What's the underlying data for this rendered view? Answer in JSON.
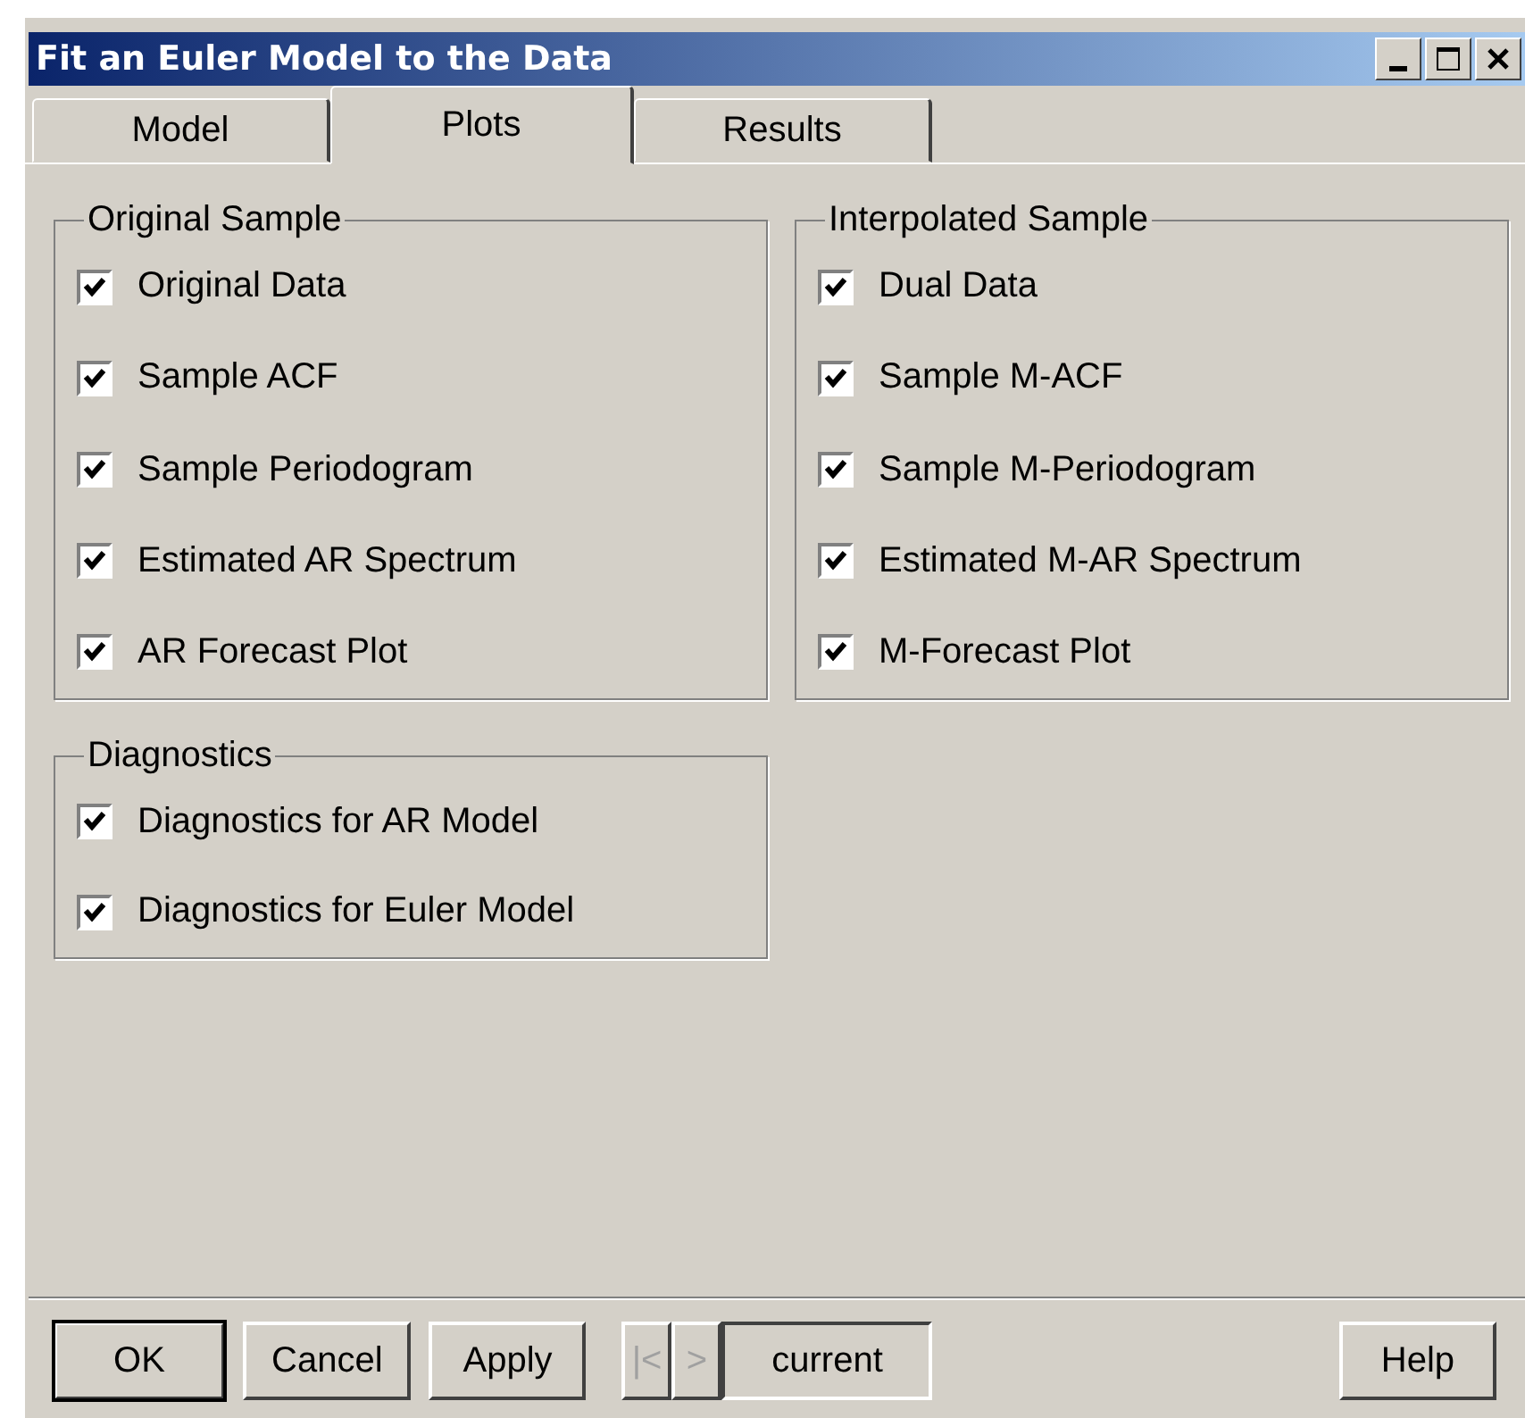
{
  "window": {
    "title": "Fit an Euler Model to the Data"
  },
  "tabs": [
    {
      "label": "Model",
      "selected": false
    },
    {
      "label": "Plots",
      "selected": true
    },
    {
      "label": "Results",
      "selected": false
    }
  ],
  "groups": [
    {
      "title": "Original Sample",
      "items": [
        {
          "label": "Original Data",
          "checked": true
        },
        {
          "label": "Sample ACF",
          "checked": true
        },
        {
          "label": "Sample Periodogram",
          "checked": true
        },
        {
          "label": "Estimated AR Spectrum",
          "checked": true
        },
        {
          "label": "AR Forecast Plot",
          "checked": true
        }
      ]
    },
    {
      "title": "Interpolated Sample",
      "items": [
        {
          "label": "Dual Data",
          "checked": true
        },
        {
          "label": "Sample M-ACF",
          "checked": true
        },
        {
          "label": "Sample M-Periodogram",
          "checked": true
        },
        {
          "label": "Estimated M-AR Spectrum",
          "checked": true
        },
        {
          "label": "M-Forecast Plot",
          "checked": true
        }
      ]
    },
    {
      "title": "Diagnostics",
      "items": [
        {
          "label": "Diagnostics for AR Model",
          "checked": true
        },
        {
          "label": "Diagnostics for Euler Model",
          "checked": true
        }
      ]
    }
  ],
  "buttons": [
    {
      "label": "OK",
      "default": true
    },
    {
      "label": "Cancel",
      "default": false
    },
    {
      "label": "Apply",
      "default": false
    }
  ],
  "navigator": {
    "first": "|<",
    "next": ">",
    "disabled": true,
    "value": "current"
  },
  "help_button": "Help"
}
